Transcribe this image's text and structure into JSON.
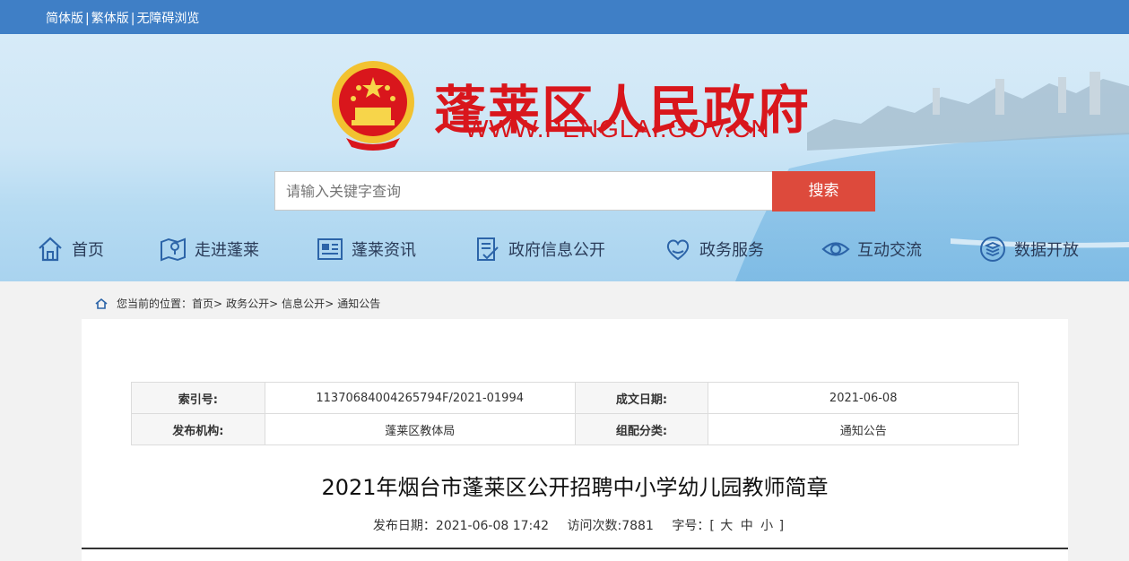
{
  "topbar": {
    "simplified": "简体版",
    "traditional": "繁体版",
    "accessible": "无障碍浏览",
    "separator": "|"
  },
  "header": {
    "title": "蓬莱区人民政府",
    "url": "WWW.PENGLAI.GOV.CN",
    "emblem_icon": "national-emblem-icon"
  },
  "search": {
    "placeholder": "请输入关键字查询",
    "button": "搜索"
  },
  "nav": [
    {
      "label": "首页",
      "icon": "home-icon"
    },
    {
      "label": "走进蓬莱",
      "icon": "map-icon"
    },
    {
      "label": "蓬莱资讯",
      "icon": "news-icon"
    },
    {
      "label": "政府信息公开",
      "icon": "document-icon"
    },
    {
      "label": "政务服务",
      "icon": "heart-hands-icon"
    },
    {
      "label": "互动交流",
      "icon": "eye-icon"
    },
    {
      "label": "数据开放",
      "icon": "database-icon"
    }
  ],
  "breadcrumb": {
    "prefix": "您当前的位置：",
    "items": [
      "首页",
      "政务公开",
      "信息公开",
      "通知公告"
    ],
    "sep": ">"
  },
  "meta": {
    "index_label": "索引号:",
    "index_value": "11370684004265794F/2021-01994",
    "date_label": "成文日期:",
    "date_value": "2021-06-08",
    "org_label": "发布机构:",
    "org_value": "蓬莱区教体局",
    "cat_label": "组配分类:",
    "cat_value": "通知公告"
  },
  "article": {
    "title": "2021年烟台市蓬莱区公开招聘中小学幼儿园教师简章",
    "publish": "发布日期：2021-06-08 17:42",
    "visits": "访问次数:7881",
    "font_label": "字号：[",
    "font_large": "大",
    "font_medium": "中",
    "font_small": "小",
    "font_close": "]"
  },
  "colors": {
    "topbar": "#3f7fc6",
    "title_red": "#d9161c",
    "search_button": "#dd4a3c",
    "nav_text": "#2a3b58",
    "icon_blue": "#2c64a8"
  }
}
